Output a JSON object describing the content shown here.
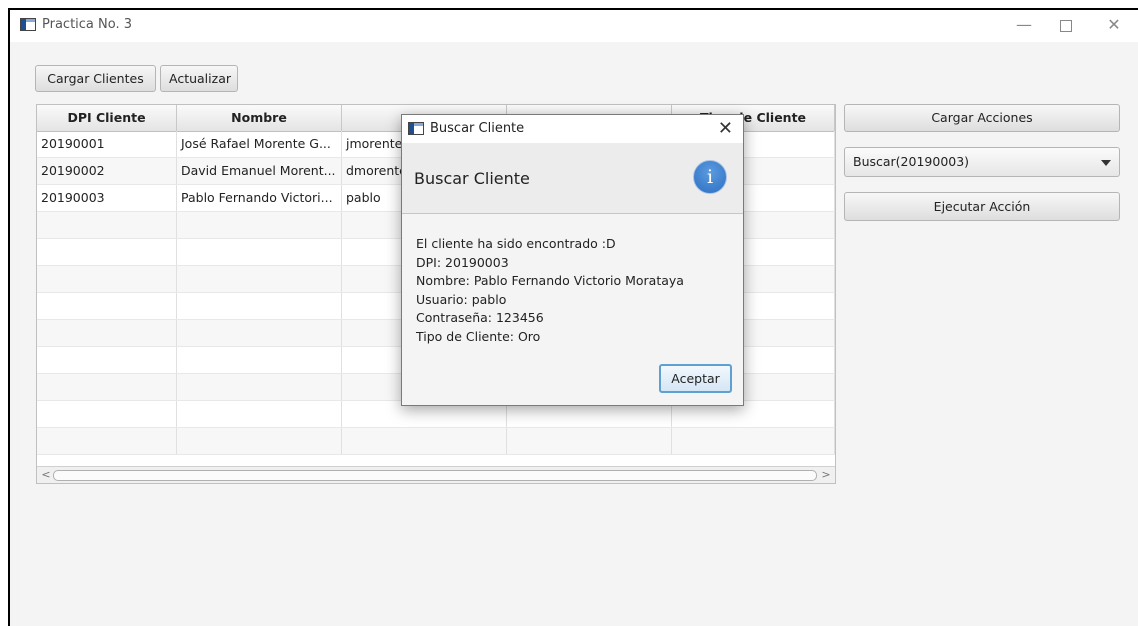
{
  "window": {
    "title": "Practica No. 3",
    "minimize": "—",
    "close": "✕"
  },
  "toolbar": {
    "cargar_clientes": "Cargar Clientes",
    "actualizar": "Actualizar"
  },
  "table": {
    "columns": [
      "DPI Cliente",
      "Nombre",
      "",
      "",
      "Tipo de Cliente"
    ],
    "rows": [
      [
        "20190001",
        "José Rafael Morente G...",
        "jmorente",
        "",
        ""
      ],
      [
        "20190002",
        "David Emanuel Morent...",
        "dmorente",
        "",
        ""
      ],
      [
        "20190003",
        "Pablo Fernando Victori...",
        "pablo",
        "",
        ""
      ]
    ]
  },
  "actions": {
    "cargar_acciones": "Cargar Acciones",
    "selected_action": "Buscar(20190003)",
    "ejecutar_accion": "Ejecutar Acción"
  },
  "dialog": {
    "title": "Buscar Cliente",
    "header": "Buscar Cliente",
    "info_glyph": "i",
    "close": "✕",
    "lines": [
      "El cliente ha sido encontrado :D",
      "DPI: 20190003",
      "Nombre: Pablo Fernando Victorio Morataya",
      "Usuario: pablo",
      "Contraseña: 123456",
      "Tipo de Cliente: Oro"
    ],
    "accept": "Aceptar"
  }
}
